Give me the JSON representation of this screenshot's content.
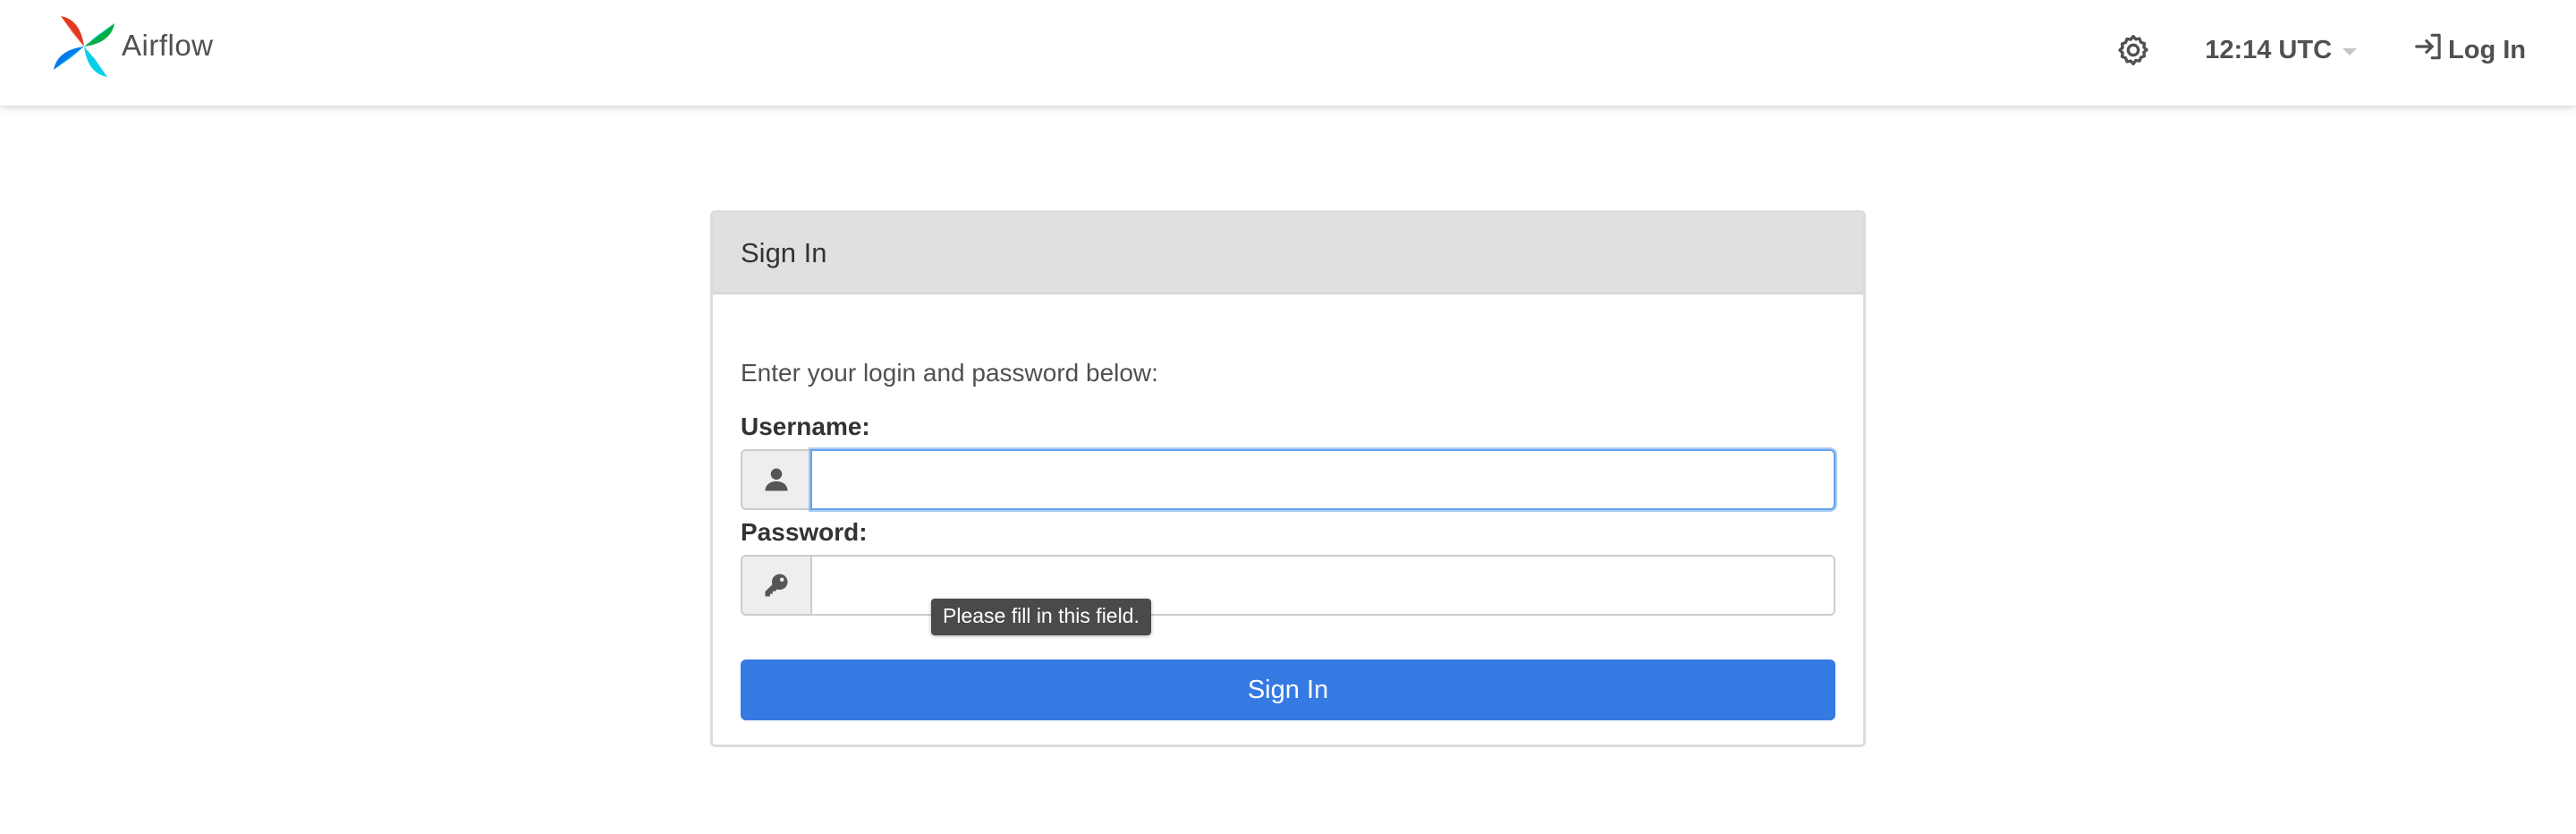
{
  "navbar": {
    "brand_name": "Airflow",
    "clock": "12:14 UTC",
    "login_label": "Log In",
    "icons": {
      "logo": "airflow-pinwheel-icon",
      "settings": "gear-icon",
      "login": "sign-in-icon"
    }
  },
  "panel": {
    "title": "Sign In",
    "intro": "Enter your login and password below:",
    "username_label": "Username:",
    "password_label": "Password:",
    "username_value": "",
    "password_value": "",
    "tooltip": "Please fill in this field.",
    "submit_label": "Sign In",
    "icons": {
      "username": "user-icon",
      "password": "key-icon"
    }
  },
  "colors": {
    "accent": "#357ae3",
    "heading_bg": "#e0e0e0",
    "text": "#51504f",
    "focus": "#66a3ec",
    "tooltip_bg": "#4a4a4a"
  }
}
